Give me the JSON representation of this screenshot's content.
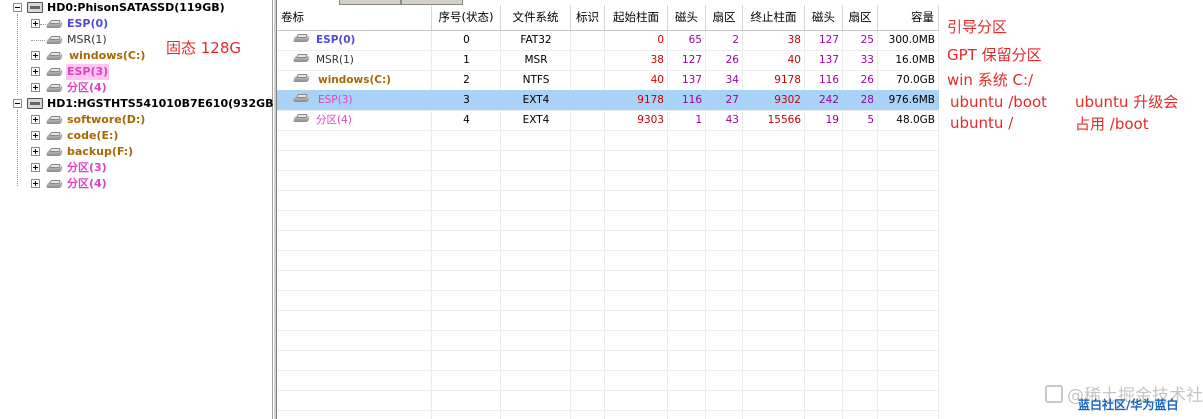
{
  "tree": {
    "disks": [
      {
        "label": "HD0:PhisonSATASSD(119GB)",
        "partitions": [
          {
            "label": "ESP(0)",
            "color": "#4b4bd8",
            "bold": true
          },
          {
            "label": "MSR(1)",
            "color": "#333333",
            "bold": false
          },
          {
            "label": "windows(C:)",
            "color": "#a76800",
            "bold": true
          },
          {
            "label": "ESP(3)",
            "color": "#e040c8",
            "bold": true,
            "selected": true
          },
          {
            "label": "分区(4)",
            "color": "#e040c8",
            "bold": true
          }
        ]
      },
      {
        "label": "HD1:HGSTHTS541010B7E610(932GB)",
        "partitions": [
          {
            "label": "softwore(D:)",
            "color": "#a76800",
            "bold": true
          },
          {
            "label": "code(E:)",
            "color": "#a76800",
            "bold": true
          },
          {
            "label": "backup(F:)",
            "color": "#a76800",
            "bold": true
          },
          {
            "label": "分区(3)",
            "color": "#e040c8",
            "bold": true
          },
          {
            "label": "分区(4)",
            "color": "#e040c8",
            "bold": true
          }
        ]
      }
    ],
    "annotation": "固态 128G"
  },
  "table": {
    "columns": [
      "卷标",
      "序号(状态)",
      "文件系统",
      "标识",
      "起始柱面",
      "磁头",
      "扇区",
      "终止柱面",
      "磁头",
      "扇区",
      "容量"
    ],
    "rows": [
      {
        "label": "ESP(0)",
        "label_color": "#4b4bd8",
        "index": "0",
        "fs": "FAT32",
        "flag": "",
        "start_cyl": "0",
        "start_head": "65",
        "start_sec": "2",
        "end_cyl": "38",
        "end_head": "127",
        "end_sec": "25",
        "size": "300.0MB",
        "note": "引导分区"
      },
      {
        "label": "MSR(1)",
        "label_color": "#333333",
        "index": "1",
        "fs": "MSR",
        "flag": "",
        "start_cyl": "38",
        "start_head": "127",
        "start_sec": "26",
        "end_cyl": "40",
        "end_head": "137",
        "end_sec": "33",
        "size": "16.0MB",
        "note": "GPT 保留分区"
      },
      {
        "label": "windows(C:)",
        "label_color": "#a76800",
        "index": "2",
        "fs": "NTFS",
        "flag": "",
        "start_cyl": "40",
        "start_head": "137",
        "start_sec": "34",
        "end_cyl": "9178",
        "end_head": "116",
        "end_sec": "26",
        "size": "70.0GB",
        "note": "win 系统 C:/"
      },
      {
        "label": "ESP(3)",
        "label_color": "#e040c8",
        "index": "3",
        "fs": "EXT4",
        "flag": "",
        "start_cyl": "9178",
        "start_head": "116",
        "start_sec": "27",
        "end_cyl": "9302",
        "end_head": "242",
        "end_sec": "28",
        "size": "976.6MB",
        "note": "ubuntu /boot",
        "selected": true
      },
      {
        "label": "分区(4)",
        "label_color": "#e040c8",
        "index": "4",
        "fs": "EXT4",
        "flag": "",
        "start_cyl": "9303",
        "start_head": "1",
        "start_sec": "43",
        "end_cyl": "15566",
        "end_head": "19",
        "end_sec": "5",
        "size": "48.0GB",
        "note": "ubuntu /"
      }
    ],
    "side_note": [
      "ubuntu 升级会",
      "占用 /boot"
    ]
  },
  "watermark": "@稀土掘金技术社区",
  "brand": "蓝白社区/华为蓝白",
  "colors": {
    "selected_row": "#a9d2f7",
    "annotation": "#e52a2a",
    "number_red": "#cc0000",
    "number_purple": "#a000a0"
  }
}
